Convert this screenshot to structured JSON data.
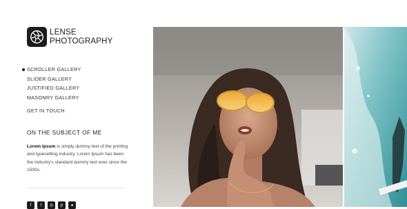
{
  "brand": {
    "line1": "LENSE",
    "line2": "PHOTOGRAPHY",
    "logo_icon": "camera-aperture-icon"
  },
  "nav": {
    "items": [
      {
        "label": "SCROLLER GALLERY",
        "active": true
      },
      {
        "label": "SLIDER GALLERY"
      },
      {
        "label": "JUSTIFIED GALLERY"
      },
      {
        "label": "MASONRY GALLERY"
      }
    ],
    "contact": "GET IN TOUCH"
  },
  "about": {
    "title": "ON THE SUBJECT OF ME",
    "lead": "Lorem Ipsum",
    "body": " is simply dummy text of the printing and typesetting industry. Lorem Ipsum has been the industry's standard dummy text ever since the 1500s."
  },
  "social_icons": [
    "facebook-icon",
    "twitter-icon",
    "instagram-icon",
    "pinterest-icon",
    "dribbble-icon"
  ],
  "colors": {
    "accent": "#1c1c1c",
    "background": "#ffffff"
  }
}
